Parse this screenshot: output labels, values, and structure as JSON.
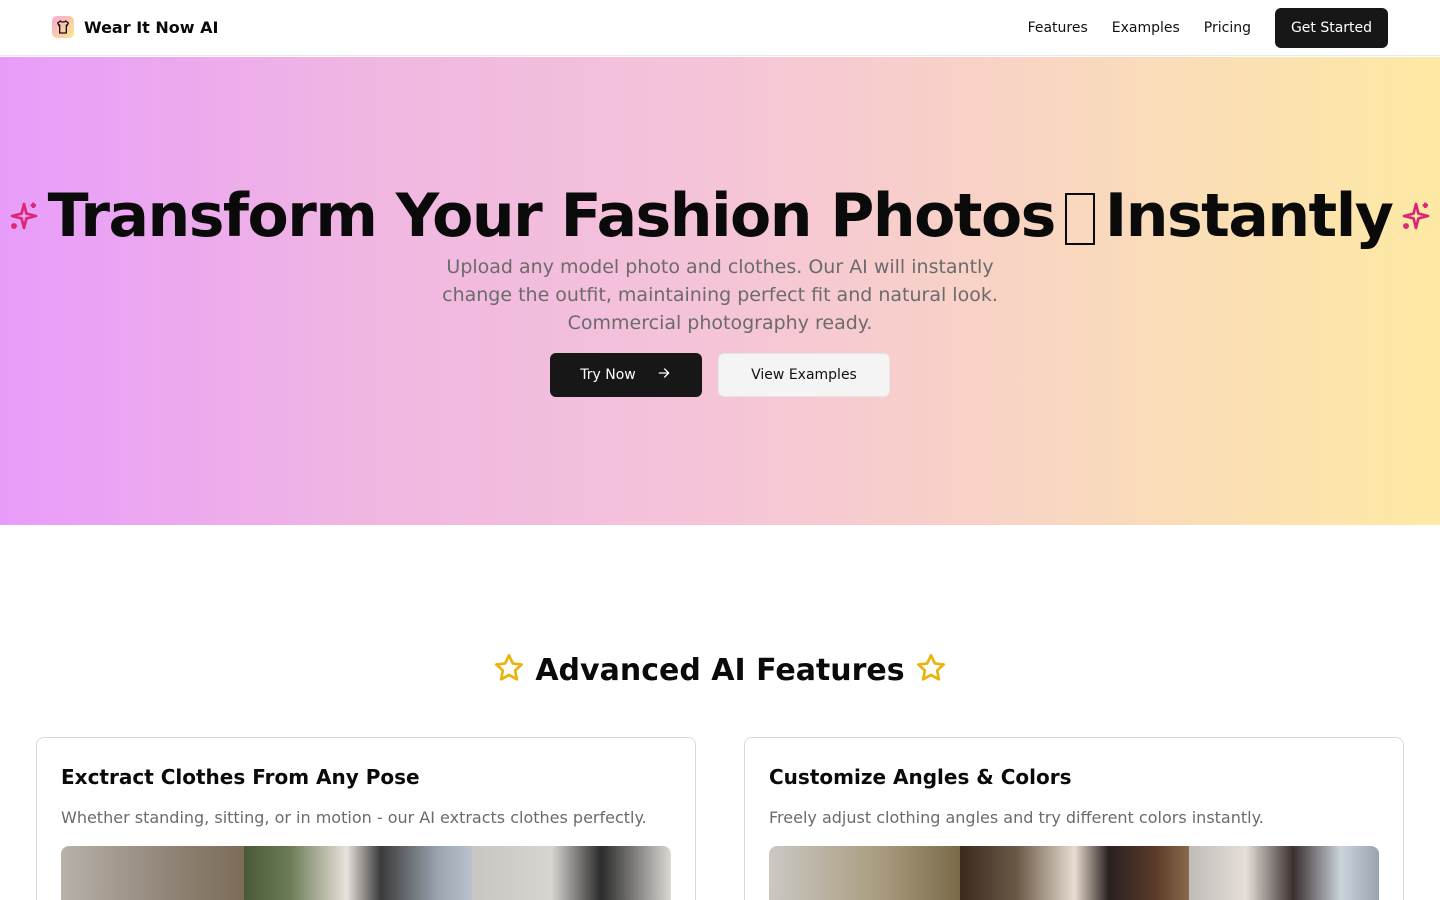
{
  "nav": {
    "brand": "Wear It Now AI",
    "links": [
      "Features",
      "Examples",
      "Pricing"
    ],
    "cta": "Get Started"
  },
  "hero": {
    "title_part1": "Transform Your Fashion Photos",
    "title_part2": "Instantly",
    "subtitle": "Upload any model photo and clothes. Our AI will instantly change the outfit, maintaining perfect fit and natural look. Commercial photography ready.",
    "primary_button": "Try Now",
    "secondary_button": "View Examples"
  },
  "features": {
    "heading": "Advanced AI Features",
    "cards": [
      {
        "title": "Exctract Clothes From Any Pose",
        "description": "Whether standing, sitting, or in motion - our AI extracts clothes perfectly."
      },
      {
        "title": "Customize Angles & Colors",
        "description": "Freely adjust clothing angles and try different colors instantly."
      }
    ]
  },
  "colors": {
    "accent_pink": "#db2777",
    "star_gold": "#eab308",
    "button_dark": "#171717",
    "gradient_start": "#e89cfa",
    "gradient_end": "#fde9a3"
  },
  "icons": [
    "shirt-icon",
    "sparkles-icon",
    "arrow-right-icon",
    "star-icon"
  ]
}
